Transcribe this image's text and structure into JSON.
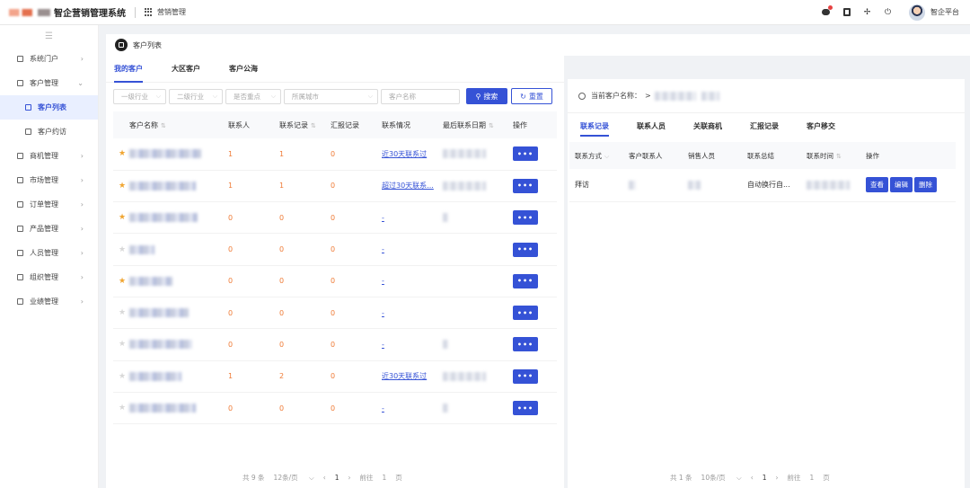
{
  "header": {
    "system_title": "智企营销管理系统",
    "module": "营销管理",
    "user_name": "智企平台"
  },
  "sidebar": {
    "items": [
      {
        "label": "系统门户",
        "arrow": "›"
      },
      {
        "label": "客户管理",
        "arrow": "⌄"
      },
      {
        "label": "客户列表",
        "sub": true,
        "active": true
      },
      {
        "label": "客户约访",
        "sub": true
      },
      {
        "label": "商机管理",
        "arrow": "›"
      },
      {
        "label": "市场管理",
        "arrow": "›"
      },
      {
        "label": "订单管理",
        "arrow": "›"
      },
      {
        "label": "产品管理",
        "arrow": "›"
      },
      {
        "label": "人员管理",
        "arrow": "›"
      },
      {
        "label": "组织管理",
        "arrow": "›"
      },
      {
        "label": "业绩管理",
        "arrow": "›"
      }
    ]
  },
  "page": {
    "title": "客户列表"
  },
  "left": {
    "tabs": [
      "我的客户",
      "大区客户",
      "客户公海"
    ],
    "filters": {
      "industry1": "一级行业",
      "industry2": "二级行业",
      "key_point": "是否重点",
      "city": "所属城市",
      "name_placeholder": "客户名称"
    },
    "search_label": "搜索",
    "reset_label": "重置",
    "columns": [
      "客户名称",
      "联系人",
      "联系记录",
      "汇报记录",
      "联系情况",
      "最后联系日期",
      "操作"
    ],
    "rows": [
      {
        "star": true,
        "contacts": "1",
        "records": "1",
        "reports": "0",
        "status": "近30天联系过",
        "link": true
      },
      {
        "star": true,
        "contacts": "1",
        "records": "1",
        "reports": "0",
        "status": "超过30天联系...",
        "link": true
      },
      {
        "star": true,
        "contacts": "0",
        "records": "0",
        "reports": "0",
        "status": "-",
        "link": true
      },
      {
        "star": false,
        "contacts": "0",
        "records": "0",
        "reports": "0",
        "status": "-",
        "link": true
      },
      {
        "star": true,
        "contacts": "0",
        "records": "0",
        "reports": "0",
        "status": "-",
        "link": true
      },
      {
        "star": false,
        "contacts": "0",
        "records": "0",
        "reports": "0",
        "status": "-",
        "link": true
      },
      {
        "star": false,
        "contacts": "0",
        "records": "0",
        "reports": "0",
        "status": "-",
        "link": true
      },
      {
        "star": false,
        "contacts": "1",
        "records": "2",
        "reports": "0",
        "status": "近30天联系过",
        "link": true
      },
      {
        "star": false,
        "contacts": "0",
        "records": "0",
        "reports": "0",
        "status": "-",
        "link": true
      }
    ],
    "action_label": "•••",
    "pager": {
      "total": "共 9 条",
      "page_size": "12条/页",
      "current": "1",
      "goto": "前往",
      "goto_value": "1",
      "page_unit": "页"
    }
  },
  "right": {
    "current_label": "当前客户名称：",
    "current_prefix": ">",
    "tabs": [
      "联系记录",
      "联系人员",
      "关联商机",
      "汇报记录",
      "客户移交"
    ],
    "columns": [
      "联系方式",
      "客户联系人",
      "销售人员",
      "联系总结",
      "联系时间",
      "操作"
    ],
    "rows": [
      {
        "method": "拜访",
        "summary": "自动换行自..."
      }
    ],
    "actions": {
      "view": "查看",
      "edit": "编辑",
      "delete": "删除"
    },
    "pager": {
      "total": "共 1 条",
      "page_size": "10条/页",
      "current": "1",
      "goto": "前往",
      "goto_value": "1",
      "page_unit": "页"
    }
  }
}
